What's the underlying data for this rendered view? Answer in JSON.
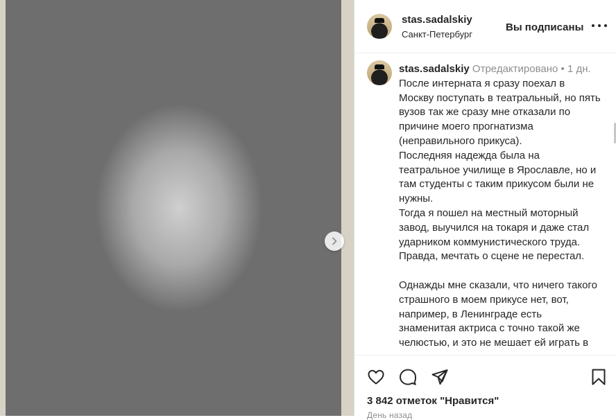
{
  "post": {
    "author": "stas.sadalskiy",
    "location": "Санкт-Петербург",
    "follow_status": "Вы подписаны",
    "caption": {
      "author": "stas.sadalskiy",
      "edited_label": "Отредактировано",
      "separator": "•",
      "age": "1 дн.",
      "text": "После интерната я сразу поехал в Москву поступать в театральный, но пять вузов так же сразу мне отказали по причине моего прогнатизма (неправильного прикуса).\nПоследняя надежда была на театральное училище в Ярославле, но и там студенты с таким прикусом были не нужны.\nТогда я пошел на местный моторный завод, выучился на токаря и даже стал ударником коммунистического труда. Правда, мечтать о сцене не перестал.\n\nОднажды мне сказали, что ничего такого страшного в моем прикусе нет, вот, например, в Ленинграде есть знаменитая актриса с точно такой же челюстью, и это не мешает ей играть в"
    },
    "likes": "3 842 отметок \"Нравится\"",
    "timestamp": "День назад"
  },
  "icons": {
    "more": "more-options-icon",
    "next": "chevron-right-icon",
    "like": "heart-icon",
    "comment": "comment-icon",
    "share": "share-icon",
    "save": "bookmark-icon"
  },
  "colors": {
    "text": "#262626",
    "muted": "#8e8e8e",
    "border": "#dbdbdb"
  }
}
